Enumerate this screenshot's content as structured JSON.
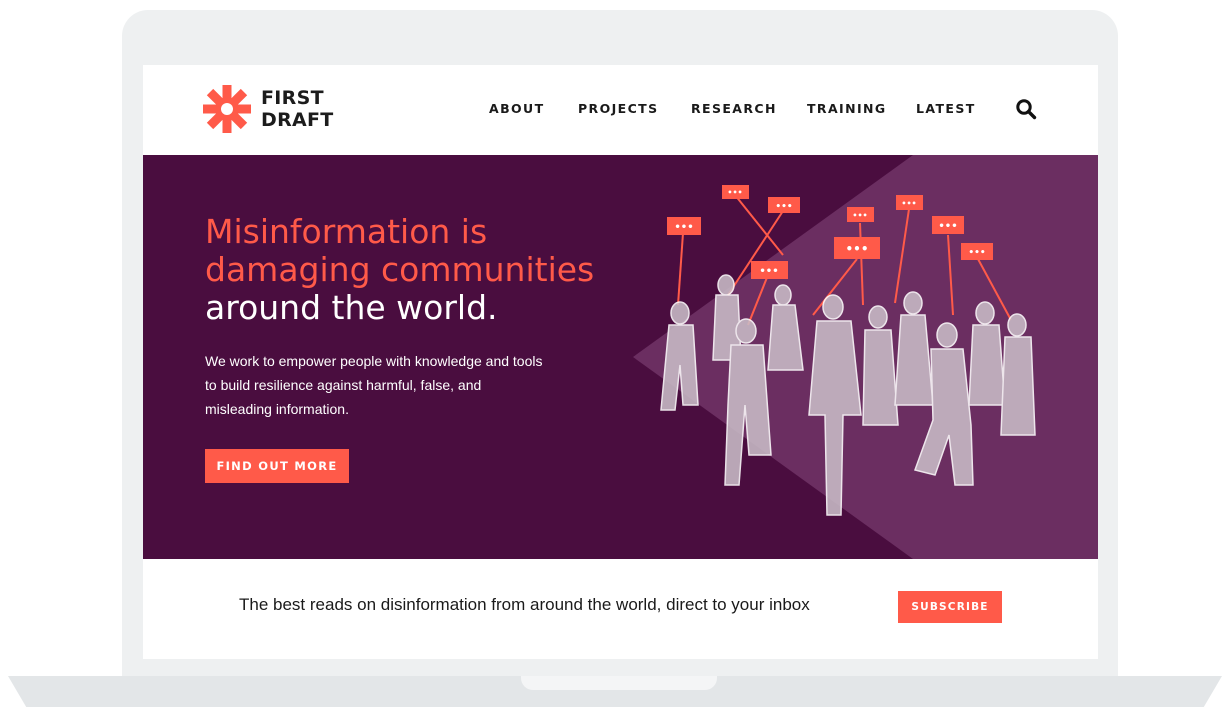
{
  "brand": {
    "line1": "FIRST",
    "line2": "DRAFT",
    "accent_color": "#ff5a49",
    "hero_bg_color": "#4a0d3f"
  },
  "nav": {
    "items": [
      {
        "label": "ABOUT"
      },
      {
        "label": "PROJECTS"
      },
      {
        "label": "RESEARCH"
      },
      {
        "label": "TRAINING"
      },
      {
        "label": "LATEST"
      }
    ],
    "search_icon": "search-icon"
  },
  "hero": {
    "title_accent_1": "Misinformation is",
    "title_accent_2": "damaging communities",
    "title_rest": "around the world.",
    "description": "We work to empower people with knowledge and tools to build resilience against harmful, false, and misleading information.",
    "cta_label": "FIND OUT MORE",
    "chat_bubble_text": "•••"
  },
  "newsletter": {
    "text": "The best reads on disinformation from around the world, direct to your inbox",
    "button_label": "SUBSCRIBE"
  }
}
